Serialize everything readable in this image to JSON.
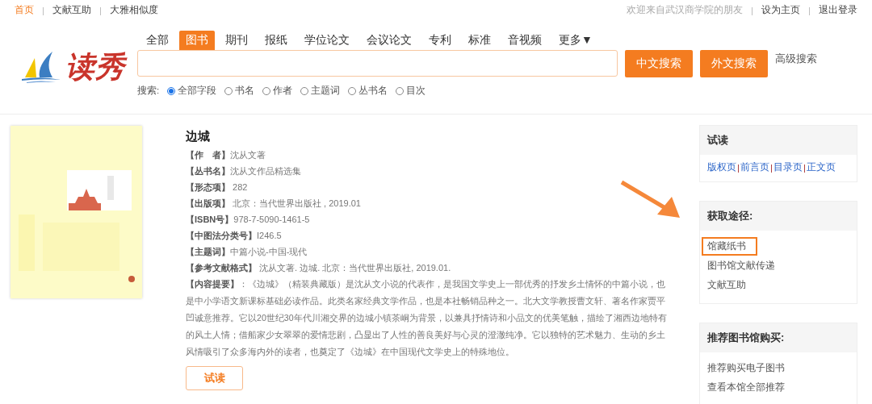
{
  "top_nav": {
    "separator": "|",
    "left": [
      {
        "label": "首页",
        "selected": true
      },
      {
        "label": "文献互助",
        "selected": false
      },
      {
        "label": "大雅相似度",
        "selected": false
      }
    ],
    "welcome": "欢迎来自武汉商学院的朋友",
    "right": [
      "设为主页",
      "退出登录"
    ]
  },
  "logo": {
    "text": "读秀"
  },
  "tabs": [
    {
      "label": "全部",
      "selected": false
    },
    {
      "label": "图书",
      "selected": true
    },
    {
      "label": "期刊",
      "selected": false
    },
    {
      "label": "报纸",
      "selected": false
    },
    {
      "label": "学位论文",
      "selected": false
    },
    {
      "label": "会议论文",
      "selected": false
    },
    {
      "label": "专利",
      "selected": false
    },
    {
      "label": "标准",
      "selected": false
    },
    {
      "label": "音视频",
      "selected": false
    },
    {
      "label": "更多▼",
      "selected": false
    }
  ],
  "search": {
    "buttons": [
      "中文搜索",
      "外文搜索"
    ],
    "advanced": "高级搜索",
    "scope_label": "搜索:",
    "scopes": [
      {
        "label": "全部字段",
        "selected": true
      },
      {
        "label": "书名",
        "selected": false
      },
      {
        "label": "作者",
        "selected": false
      },
      {
        "label": "主题词",
        "selected": false
      },
      {
        "label": "丛书名",
        "selected": false
      },
      {
        "label": "目次",
        "selected": false
      }
    ]
  },
  "book": {
    "title": "边城",
    "fields": [
      {
        "label": "【作　者】",
        "value": "沈从文著"
      },
      {
        "label": "【丛书名】",
        "value": "沈从文作品精选集"
      },
      {
        "label": "【形态项】",
        "value": " 282"
      },
      {
        "label": "【出版项】",
        "value": " 北京：当代世界出版社 , 2019.01"
      },
      {
        "label": "【ISBN号】",
        "value": "978-7-5090-1461-5"
      },
      {
        "label": "【中图法分类号】",
        "value": "I246.5"
      },
      {
        "label": "【主题词】",
        "value": "中篇小说-中国-现代"
      },
      {
        "label": "【参考文献格式】",
        "value": " 沈从文著. 边城. 北京：当代世界出版社, 2019.01."
      }
    ],
    "summary": "**【内容提要】**：《边城》（精装典藏版）是沈从文小说的代表作，是我国文学史上一部优秀的抒发乡土情怀的中篇小说，也是中小学语文新课标基础必读作品。此类名家经典文学作品，也是本社畅销品种之一。北大文学教授曹文轩、著名作家贾平凹诚意推荐。它以20世纪30年代川湘交界的边城小镇茶峒为背景，以兼具抒情诗和小品文的优美笔触，描绘了湘西边地特有的风土人情；借船家少女翠翠的爱情悲剧，凸显出了人性的善良美好与心灵的澄澈纯净。它以独特的艺术魅力、生动的乡土风情吸引了众多海内外的读者，也奠定了《边城》在中国现代文学史上的特殊地位。",
    "read_button": "试读"
  },
  "sidebar": [
    {
      "title": "试读",
      "kind": "inline",
      "separator": "|",
      "items": [
        "版权页",
        "前言页",
        "目录页 ",
        "正文页"
      ]
    },
    {
      "title": "获取途径:",
      "kind": "list",
      "items": [
        {
          "label": "馆藏纸书",
          "highlighted": true
        },
        {
          "label": "图书馆文献传递",
          "highlighted": false
        },
        {
          "label": "文献互助",
          "highlighted": false
        }
      ]
    },
    {
      "title": "推荐图书馆购买:",
      "kind": "list",
      "items": [
        {
          "label": "推荐购买电子图书",
          "highlighted": false
        },
        {
          "label": "查看本馆全部推荐",
          "highlighted": false
        }
      ]
    }
  ]
}
